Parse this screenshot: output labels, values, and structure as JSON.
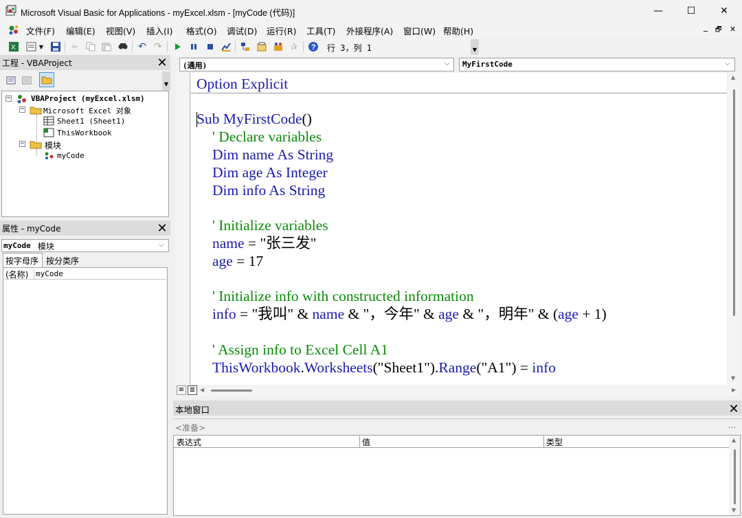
{
  "window": {
    "title": "Microsoft Visual Basic for Applications - myExcel.xlsm - [myCode (代码)]",
    "minimize_glyph": "—",
    "maximize_glyph": "☐",
    "close_glyph": "✕"
  },
  "menu": {
    "items": [
      "文件(F)",
      "编辑(E)",
      "视图(V)",
      "插入(I)",
      "格式(O)",
      "调试(D)",
      "运行(R)",
      "工具(T)",
      "外接程序(A)",
      "窗口(W)",
      "帮助(H)"
    ],
    "doc_controls": [
      "_",
      "🗗",
      "✕"
    ]
  },
  "toolbar": {
    "position": "行 3，列 1",
    "icons": [
      "excel-icon",
      "insert-module-icon",
      "save-icon",
      "cut-icon",
      "copy-icon",
      "paste-icon",
      "find-icon",
      "undo-icon",
      "redo-icon",
      "run-icon",
      "break-icon",
      "reset-icon",
      "design-mode-icon",
      "project-explorer-icon",
      "properties-icon",
      "object-browser-icon",
      "toolbox-icon",
      "help-icon"
    ]
  },
  "project_panel": {
    "title": "工程 - VBAProject",
    "tree": {
      "root": "VBAProject (myExcel.xlsm)",
      "folder_objects": "Microsoft Excel 对象",
      "sheet1": "Sheet1 (Sheet1)",
      "workbook": "ThisWorkbook",
      "folder_modules": "模块",
      "module": "myCode"
    }
  },
  "properties_panel": {
    "title": "属性 - myCode",
    "object_select_bold": "myCode",
    "object_select_rest": " 模块",
    "tabs": [
      "按字母序",
      "按分类序"
    ],
    "prop_name": "(名称)",
    "prop_value": "myCode"
  },
  "code_window": {
    "object_dropdown": "(通用)",
    "procedure_dropdown": "MyFirstCode",
    "lines": {
      "l1": "Option Explicit",
      "l2a": "Sub",
      "l2b": " MyFirstCode",
      "l2c": "()",
      "l3": "' Declare variables",
      "l4a": "Dim name As String",
      "l5a": "Dim",
      "l5b": " age ",
      "l5c": "As Integer",
      "l6a": "Dim info As String",
      "l7": "' Initialize variables",
      "l8a": "name",
      "l8b": " = \"张三发\"",
      "l9a": "age",
      "l9b": " = 17",
      "l10": "' Initialize info with constructed information",
      "l11a": "info",
      "l11b": " = \"我叫\" & ",
      "l11c": "name",
      "l11d": " & \"，今年\" & ",
      "l11e": "age",
      "l11f": " & \"，明年\" & (",
      "l11g": "age",
      "l11h": " + 1)",
      "l12": "' Assign info to Excel Cell A1",
      "l13a": "ThisWorkbook",
      "l13b": ".",
      "l13c": "Worksheets",
      "l13d": "(\"Sheet1\").",
      "l13e": "Range",
      "l13f": "(\"A1\") = ",
      "l13g": "info"
    }
  },
  "locals_window": {
    "title": "本地窗口",
    "status": "<准备>",
    "ellipsis": "...",
    "columns": [
      "表达式",
      "值",
      "类型"
    ]
  }
}
